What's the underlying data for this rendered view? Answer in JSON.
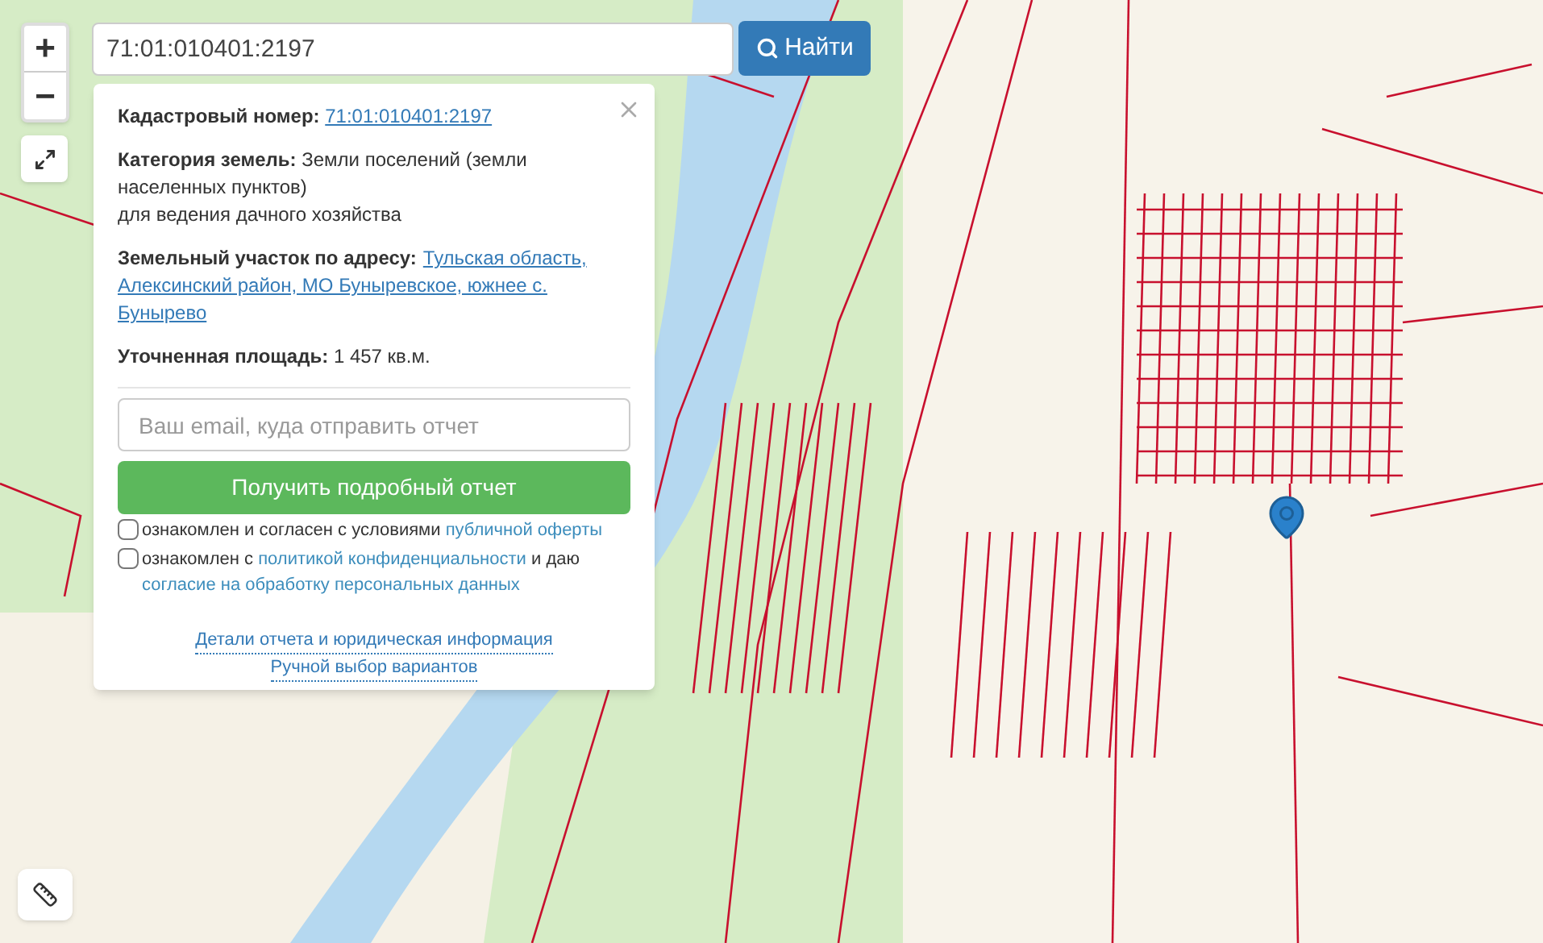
{
  "zoom_controls": {
    "zoom_in": "+",
    "zoom_out": "−"
  },
  "search": {
    "value": "71:01:010401:2197"
  },
  "search_button": {
    "label": "Найти"
  },
  "popup": {
    "cadastral": {
      "label": "Кадастровый номер:",
      "link": "71:01:010401:2197"
    },
    "category": {
      "text": "**Категория земель:** Земли поселений (земли населенных пунктов)",
      "note": "для ведения дачного хозяйства"
    },
    "address": {
      "label": "Земельный участок по адресу:",
      "link_lines": [
        "Тульская область,",
        "Алексинский район, МО Буныревское, южнее с.",
        "Бунырево"
      ]
    },
    "area": {
      "label": "Уточненная площадь:",
      "value": "1 457 кв.м."
    },
    "email": {
      "placeholder": "Ваш email, куда отправить отчет"
    },
    "submit_button": "Получить подробный отчет",
    "consents": [
      {
        "checked": false,
        "parts": [
          {
            "kind": "text",
            "text": "ознакомлен и согласен с условиями"
          },
          {
            "kind": "link",
            "text": "публичной оферты"
          }
        ]
      },
      {
        "checked": false,
        "parts": [
          {
            "kind": "text",
            "text": "ознакомлен с"
          },
          {
            "kind": "link",
            "text": "политикой конфиденциальности"
          },
          {
            "kind": "text",
            "text": "и даю"
          },
          {
            "kind": "link",
            "text": "согласие на обработку персональных данных"
          }
        ]
      }
    ],
    "links": [
      "Детали отчета и юридическая информация",
      "Ручной выбор вариантов"
    ]
  }
}
